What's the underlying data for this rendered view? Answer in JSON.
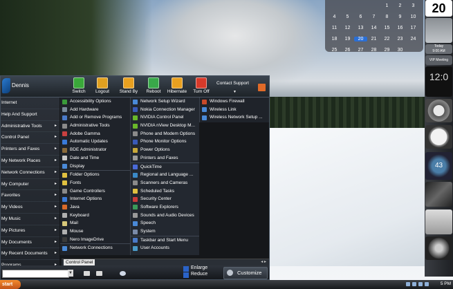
{
  "calendar": {
    "rows": [
      [
        "",
        "",
        "",
        "",
        "1",
        "2",
        "3"
      ],
      [
        "4",
        "5",
        "6",
        "7",
        "8",
        "9",
        "10"
      ],
      [
        "11",
        "12",
        "13",
        "14",
        "15",
        "16",
        "17"
      ],
      [
        "18",
        "19",
        "20",
        "21",
        "22",
        "23",
        "24"
      ],
      [
        "25",
        "26",
        "27",
        "28",
        "29",
        "30",
        ""
      ]
    ],
    "today": "20"
  },
  "sidebar": {
    "date": "20",
    "today_label": "Today",
    "today_time": "9:00 AM",
    "vip_label": "VIP Meeting",
    "clock_time": "12:0",
    "gauge_value": "43"
  },
  "start_menu": {
    "user": "Dennis",
    "power_buttons": [
      {
        "label": "Switch",
        "color": "#3aa83a"
      },
      {
        "label": "Logout",
        "color": "#e0a020"
      },
      {
        "label": "Stand By",
        "color": "#e8a020"
      },
      {
        "label": "Reboot",
        "color": "#39a84a"
      },
      {
        "label": "Hibernate",
        "color": "#e8a020"
      },
      {
        "label": "Turn Off",
        "color": "#d83a2a"
      }
    ],
    "contact_support": "Contact Support",
    "left_items": [
      {
        "label": "Internet",
        "arrow": ""
      },
      {
        "label": "Help And Support",
        "arrow": ""
      },
      {
        "label": "Administrative Tools",
        "arrow": "▸"
      },
      {
        "label": "Control Panel",
        "arrow": "▸"
      },
      {
        "label": "Printers and Faxes",
        "arrow": "▸"
      },
      {
        "label": "My Network Places",
        "arrow": "▸"
      },
      {
        "label": "Network Connections",
        "arrow": "▸"
      },
      {
        "label": "My Computer",
        "arrow": "▸"
      },
      {
        "label": "Favorites",
        "arrow": "▸"
      },
      {
        "label": "My Videos",
        "arrow": "▸"
      },
      {
        "label": "My Music",
        "arrow": "▸"
      },
      {
        "label": "My Pictures",
        "arrow": "▸"
      },
      {
        "label": "My Documents",
        "arrow": "▸"
      },
      {
        "label": "My Recent Documents",
        "arrow": "▸"
      },
      {
        "label": "Programs",
        "arrow": "▸"
      }
    ],
    "col_mid": [
      {
        "label": "Accessibility Options",
        "color": "#3a9a3a"
      },
      {
        "label": "Add Hardware",
        "color": "#7a8a9a"
      },
      {
        "label": "Add or Remove Programs",
        "color": "#4a7ac8"
      },
      {
        "label": "Administrative Tools",
        "color": "#8a8a8a"
      },
      {
        "label": "Adobe Gamma",
        "color": "#c84040"
      },
      {
        "label": "Automatic Updates",
        "color": "#3a7ad8"
      },
      {
        "label": "BDE Administrator",
        "color": "#8a6a3a"
      },
      {
        "label": "Date and Time",
        "color": "#c8c8c8"
      },
      {
        "label": "Display",
        "color": "#4a8ad8"
      },
      {
        "label": "Folder Options",
        "color": "#e0c040"
      },
      {
        "label": "Fonts",
        "color": "#e0c040"
      },
      {
        "label": "Game Controllers",
        "color": "#8a8a8a"
      },
      {
        "label": "Internet Options",
        "color": "#3a7ad8"
      },
      {
        "label": "Java",
        "color": "#d86a2a"
      },
      {
        "label": "Keyboard",
        "color": "#b0b0b0"
      },
      {
        "label": "Mail",
        "color": "#d8c87a"
      },
      {
        "label": "Mouse",
        "color": "#b0b0b0"
      },
      {
        "label": "Nero ImageDrive",
        "color": "#3a3a3a"
      },
      {
        "label": "Network Connections",
        "color": "#4a8ad8"
      }
    ],
    "col_mid2": [
      {
        "label": "Network Setup Wizard",
        "color": "#4a8ad8"
      },
      {
        "label": "Nokia Connection Manager",
        "color": "#3a5ab8"
      },
      {
        "label": "NVIDIA Control Panel",
        "color": "#6ab82a"
      },
      {
        "label": "NVIDIA nView Desktop M...",
        "color": "#6ab82a"
      },
      {
        "label": "Phone and Modem Options",
        "color": "#8a8a8a"
      },
      {
        "label": "Phone Monitor Options",
        "color": "#3a5ab8"
      },
      {
        "label": "Power Options",
        "color": "#c8a83a"
      },
      {
        "label": "Printers and Faxes",
        "color": "#9a9a9a"
      },
      {
        "label": "QuickTime",
        "color": "#4a6ad8"
      },
      {
        "label": "Regional and Language ...",
        "color": "#3a8ac8"
      },
      {
        "label": "Scanners and Cameras",
        "color": "#8a8a8a"
      },
      {
        "label": "Scheduled Tasks",
        "color": "#e0c040"
      },
      {
        "label": "Security Center",
        "color": "#c83a3a"
      },
      {
        "label": "Software Explorers",
        "color": "#3a9a5a"
      },
      {
        "label": "Sounds and Audio Devices",
        "color": "#9a9a9a"
      },
      {
        "label": "Speech",
        "color": "#4a8ad8"
      },
      {
        "label": "System",
        "color": "#7a8aa8"
      },
      {
        "label": "Taskbar and Start Menu",
        "color": "#4a7ac8"
      },
      {
        "label": "User Accounts",
        "color": "#4a9ac8"
      }
    ],
    "col_right": [
      {
        "label": "Windows Firewall",
        "color": "#c84a2a"
      },
      {
        "label": "Wireless Link",
        "color": "#4a8ad8"
      },
      {
        "label": "Wireless Network Setup ...",
        "color": "#4a8ad8"
      }
    ],
    "bottom_label": "Control Panel",
    "enlarge": "Enlarge",
    "reduce": "Reduce",
    "customize": "Customize"
  },
  "taskbar": {
    "start": "start",
    "time": "5 PM"
  }
}
